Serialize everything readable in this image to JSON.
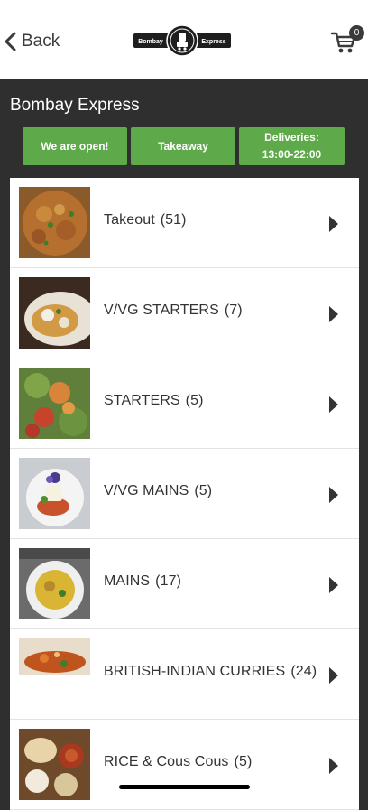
{
  "header": {
    "back_label": "Back",
    "logo_left": "Bombay",
    "logo_right": "Express",
    "cart_count": "0"
  },
  "restaurant": {
    "name": "Bombay Express"
  },
  "status": {
    "open": "We are open!",
    "mode": "Takeaway",
    "deliveries_label": "Deliveries:",
    "deliveries_hours": "13:00-22:00"
  },
  "colors": {
    "accent_green": "#5ea94a",
    "background_dark": "#2f2f2f"
  },
  "categories": [
    {
      "name": "Takeout",
      "count": "(51)",
      "thumb": "curry-bowl-image"
    },
    {
      "name": "V/VG STARTERS",
      "count": "(7)",
      "thumb": "starter-plate-image"
    },
    {
      "name": "STARTERS",
      "count": "(5)",
      "thumb": "salad-starter-image"
    },
    {
      "name": "V/VG MAINS",
      "count": "(5)",
      "thumb": "plated-main-image"
    },
    {
      "name": "MAINS",
      "count": "(17)",
      "thumb": "yellow-curry-image"
    },
    {
      "name": "BRITISH-INDIAN CURRIES",
      "count": "(24)",
      "thumb": "curry-dish-image"
    },
    {
      "name": "RICE & Cous Cous",
      "count": "(5)",
      "thumb": "rice-breads-image"
    }
  ]
}
